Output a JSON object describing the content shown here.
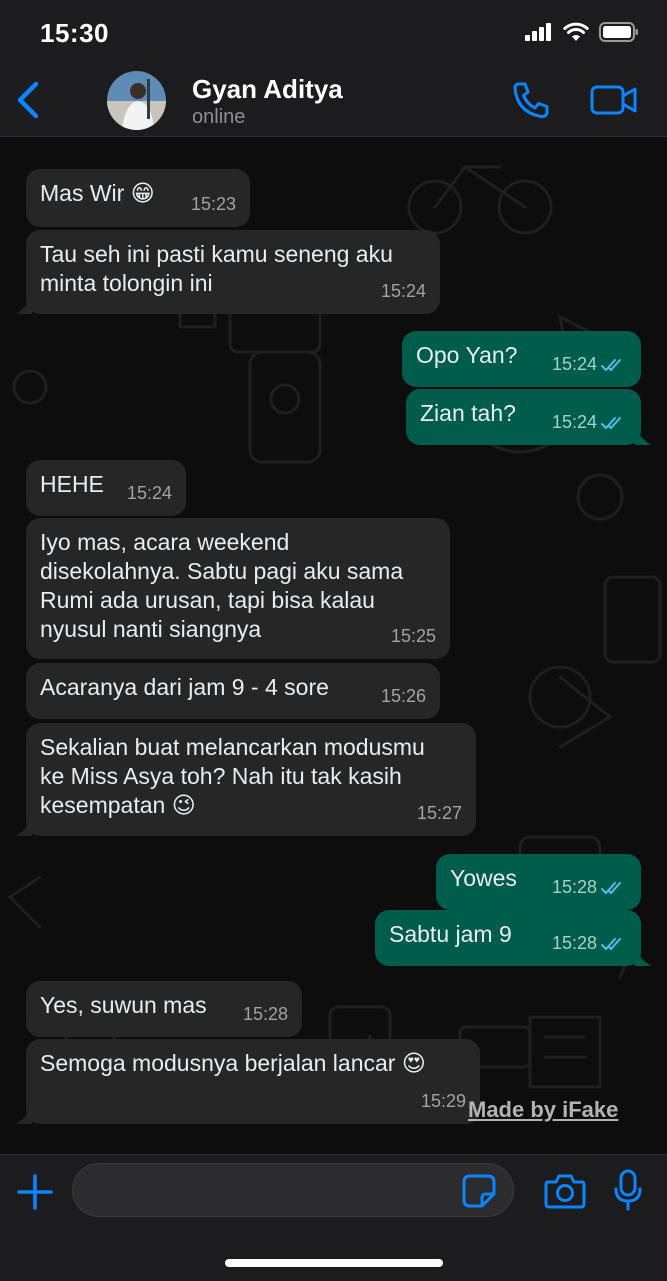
{
  "status_bar": {
    "time": "15:30"
  },
  "header": {
    "contact_name": "Gyan Aditya",
    "contact_status": "online"
  },
  "messages": [
    {
      "dir": "in",
      "text": "Mas Wir 😁",
      "time": "15:23"
    },
    {
      "dir": "in",
      "text": "Tau seh ini pasti kamu seneng aku\nminta tolongin ini",
      "time": "15:24"
    },
    {
      "dir": "out",
      "text": "Opo Yan?",
      "time": "15:24",
      "status": "read"
    },
    {
      "dir": "out",
      "text": "Zian tah?",
      "time": "15:24",
      "status": "read"
    },
    {
      "dir": "in",
      "text": "HEHE",
      "time": "15:24"
    },
    {
      "dir": "in",
      "text": "Iyo mas, acara weekend\ndisekolahnya. Sabtu pagi aku sama\nRumi ada urusan, tapi bisa kalau\nnyusul nanti siangnya",
      "time": "15:25"
    },
    {
      "dir": "in",
      "text": "Acaranya dari jam 9 - 4 sore",
      "time": "15:26"
    },
    {
      "dir": "in",
      "text": "Sekalian buat melancarkan modusmu\nke Miss Asya toh? Nah itu tak kasih\nkesempatan 😉",
      "time": "15:27"
    },
    {
      "dir": "out",
      "text": "Yowes",
      "time": "15:28",
      "status": "read"
    },
    {
      "dir": "out",
      "text": "Sabtu jam 9",
      "time": "15:28",
      "status": "read"
    },
    {
      "dir": "in",
      "text": "Yes, suwun mas",
      "time": "15:28"
    },
    {
      "dir": "in",
      "text": "Semoga modusnya berjalan lancar 😍",
      "time": "15:29"
    }
  ],
  "watermark": "Made by iFake",
  "input": {
    "placeholder": "",
    "value": ""
  },
  "colors": {
    "accent": "#0a84ff",
    "incoming_bubble": "#262626",
    "outgoing_bubble": "#005c4b",
    "read_ticks": "#53bdeb"
  }
}
